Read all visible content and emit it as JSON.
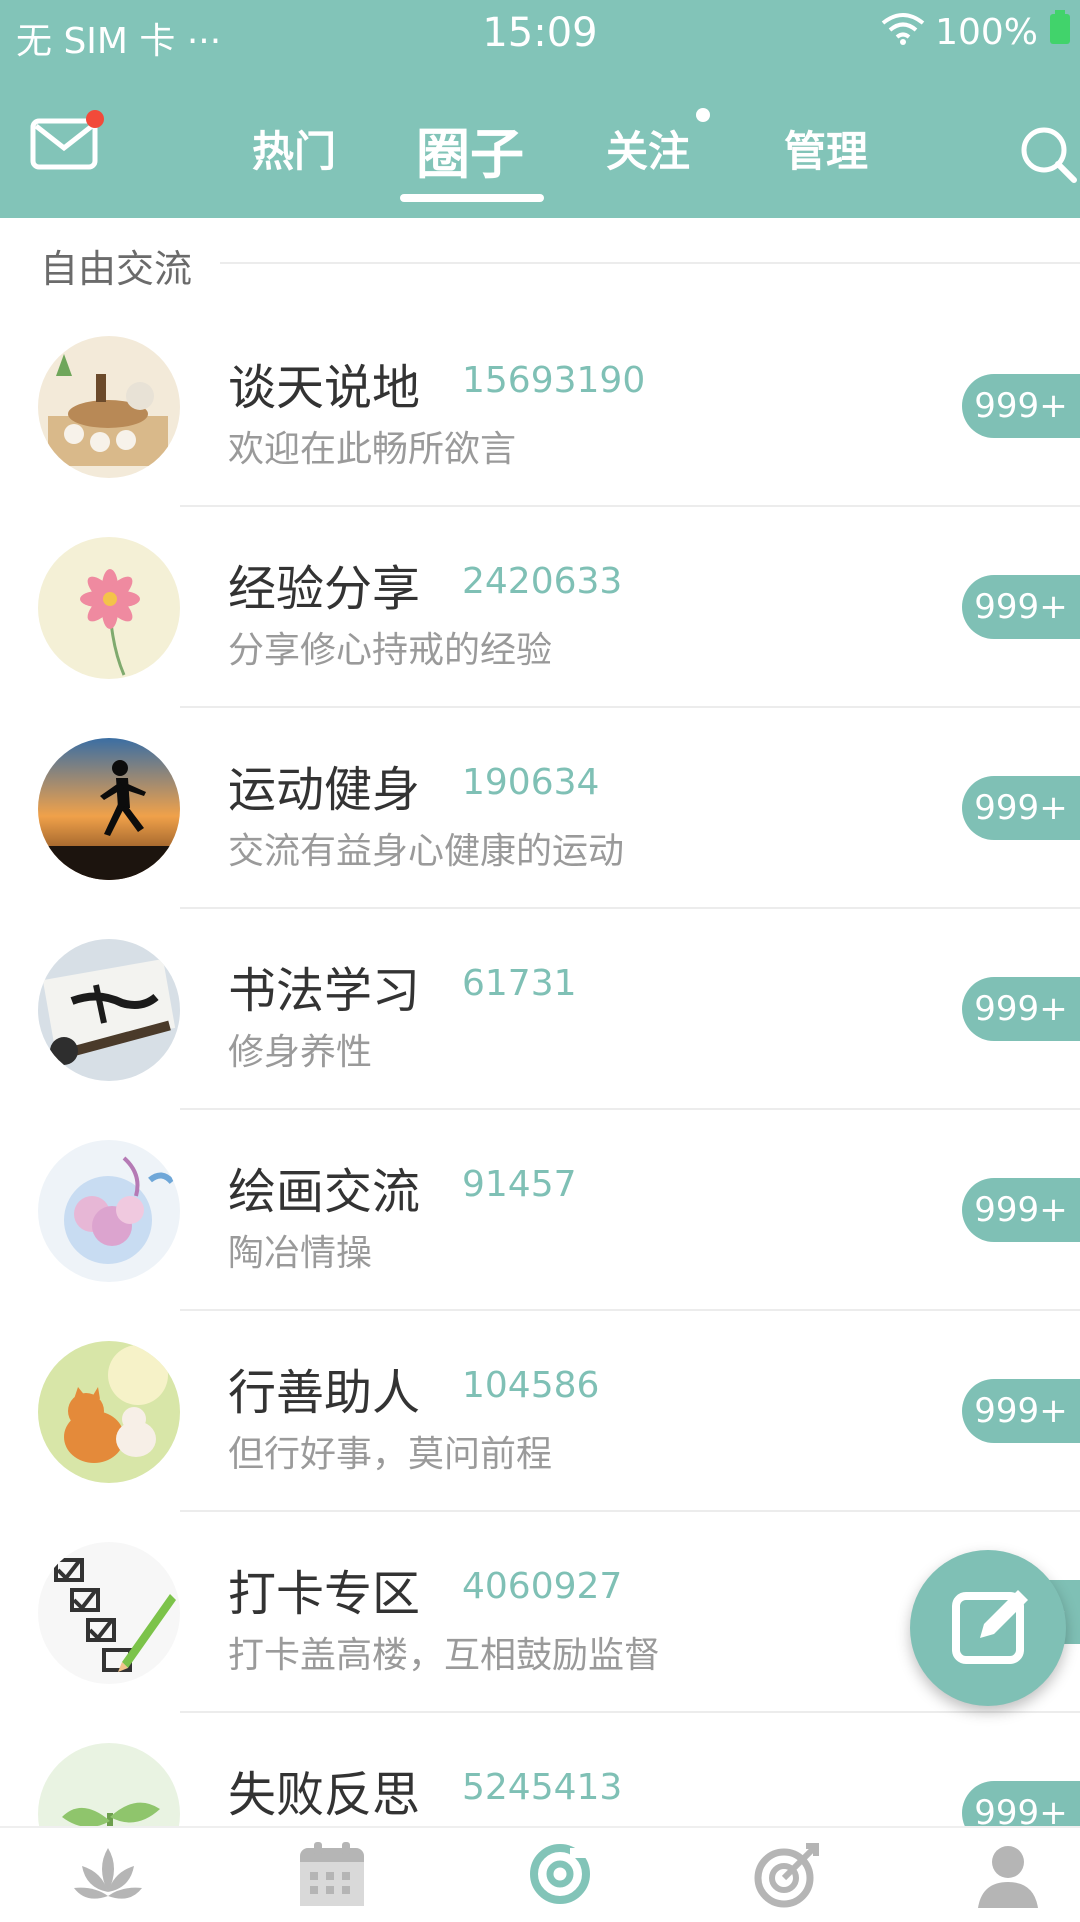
{
  "status_bar": {
    "carrier": "无 SIM 卡 ···",
    "time": "15:09",
    "battery": "100%"
  },
  "header": {
    "tabs": [
      {
        "label": "热门"
      },
      {
        "label": "圈子",
        "active": true
      },
      {
        "label": "关注"
      },
      {
        "label": "管理"
      }
    ],
    "icons": {
      "mail": "mail-icon",
      "search": "search-icon"
    },
    "colors": {
      "primary": "#82c4b8",
      "badge": "#7fc0b5",
      "notify_dot": "#f24a3a"
    }
  },
  "section": {
    "title": "自由交流"
  },
  "groups": [
    {
      "name": "谈天说地",
      "count": "15693190",
      "desc": "欢迎在此畅所欲言",
      "badge": "999+"
    },
    {
      "name": "经验分享",
      "count": "2420633",
      "desc": "分享修心持戒的经验",
      "badge": "999+"
    },
    {
      "name": "运动健身",
      "count": "190634",
      "desc": "交流有益身心健康的运动",
      "badge": "999+"
    },
    {
      "name": "书法学习",
      "count": "61731",
      "desc": "修身养性",
      "badge": "999+"
    },
    {
      "name": "绘画交流",
      "count": "91457",
      "desc": "陶冶情操",
      "badge": "999+"
    },
    {
      "name": "行善助人",
      "count": "104586",
      "desc": "但行好事，莫问前程",
      "badge": "999+"
    },
    {
      "name": "打卡专区",
      "count": "4060927",
      "desc": "打卡盖高楼，互相鼓励监督",
      "badge": "999+"
    },
    {
      "name": "失败反思",
      "count": "5245413",
      "desc": "",
      "badge": "999+"
    }
  ],
  "fab": {
    "icon": "edit-icon"
  },
  "bottom_nav": [
    {
      "icon": "lotus-icon"
    },
    {
      "icon": "calendar-icon"
    },
    {
      "icon": "circle-icon"
    },
    {
      "icon": "target-icon"
    },
    {
      "icon": "user-icon"
    }
  ]
}
